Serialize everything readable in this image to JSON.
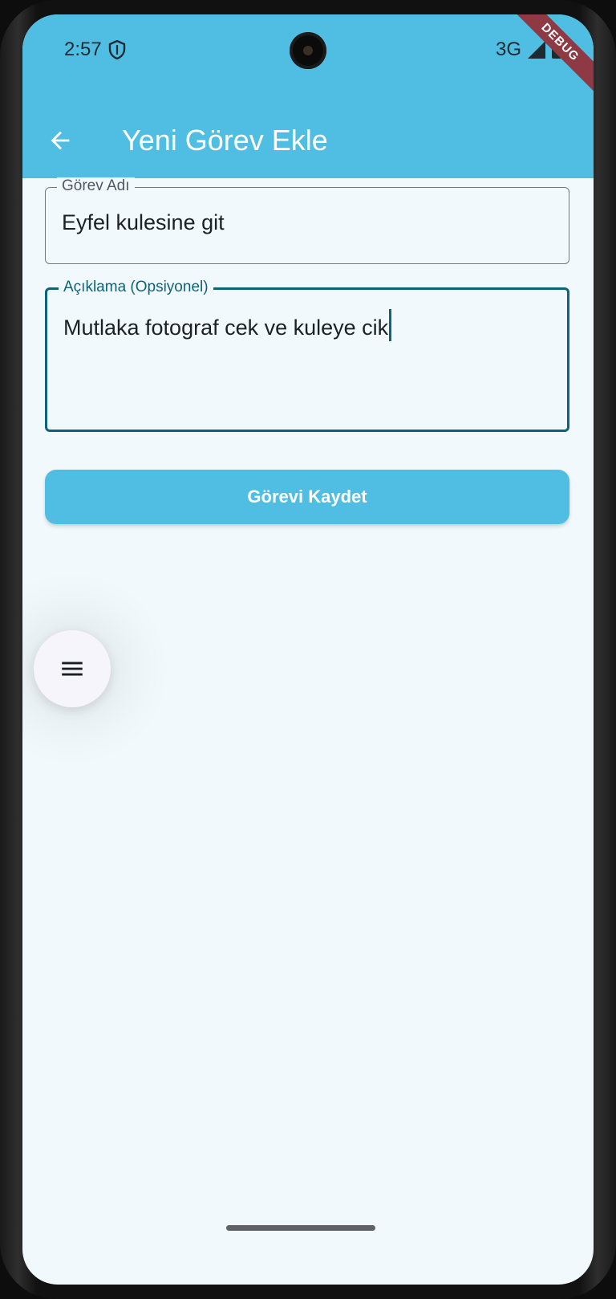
{
  "status_bar": {
    "time": "2:57",
    "network": "3G"
  },
  "debug_banner": "DEBUG",
  "app_bar": {
    "title": "Yeni Görev Ekle"
  },
  "form": {
    "task_name": {
      "label": "Görev Adı",
      "value": "Eyfel kulesine git"
    },
    "description": {
      "label": "Açıklama (Opsiyonel)",
      "value": "Mutlaka fotograf cek ve kuleye cik"
    },
    "save_button_label": "Görevi Kaydet"
  },
  "colors": {
    "primary": "#50bee3",
    "focused_border": "#0d6378",
    "background": "#f2f9fc"
  },
  "icons": {
    "back": "arrow-left-icon",
    "menu": "menu-icon",
    "vpn": "shield-icon"
  }
}
